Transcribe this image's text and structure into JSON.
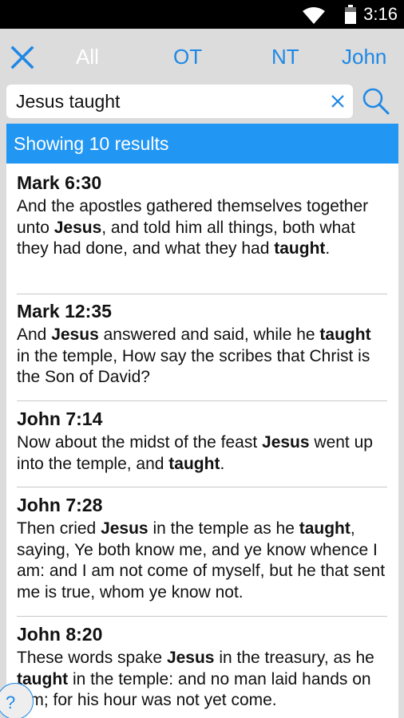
{
  "status": {
    "time": "3:16"
  },
  "scopes": [
    "All",
    "OT",
    "NT",
    "John"
  ],
  "search": {
    "query": "Jesus taught"
  },
  "results_header": "Showing 10 results",
  "results": [
    {
      "ref": "Mark 6:30",
      "segments": [
        {
          "t": "And the apostles gathered themselves together unto "
        },
        {
          "t": "Jesus",
          "b": true
        },
        {
          "t": ", and told him all things, both what they had done, and what they had "
        },
        {
          "t": "taught",
          "b": true
        },
        {
          "t": "."
        }
      ]
    },
    {
      "ref": "Mark 12:35",
      "segments": [
        {
          "t": "And "
        },
        {
          "t": "Jesus",
          "b": true
        },
        {
          "t": " answered and said, while he "
        },
        {
          "t": "taught",
          "b": true
        },
        {
          "t": " in the temple, How say the scribes that Christ is the Son of David?"
        }
      ]
    },
    {
      "ref": "John 7:14",
      "segments": [
        {
          "t": "Now about the midst of the feast "
        },
        {
          "t": "Jesus",
          "b": true
        },
        {
          "t": " went up into the temple, and "
        },
        {
          "t": "taught",
          "b": true
        },
        {
          "t": "."
        }
      ]
    },
    {
      "ref": "John 7:28",
      "segments": [
        {
          "t": "Then cried "
        },
        {
          "t": "Jesus",
          "b": true
        },
        {
          "t": " in the temple as he "
        },
        {
          "t": "taught",
          "b": true
        },
        {
          "t": ", saying, Ye both know me, and ye know whence I am: and I am not come of myself, but he that sent me is true, whom ye know not."
        }
      ]
    },
    {
      "ref": "John 8:20",
      "segments": [
        {
          "t": "These words spake "
        },
        {
          "t": "Jesus",
          "b": true
        },
        {
          "t": " in the treasury, as he "
        },
        {
          "t": "taught",
          "b": true
        },
        {
          "t": " in the temple: and no man laid hands on him; for his hour was not yet come."
        }
      ]
    }
  ],
  "help_label": "?",
  "colors": {
    "accent": "#2196f3",
    "scope_link": "#1e88e5",
    "background": "#dcdcdc"
  }
}
